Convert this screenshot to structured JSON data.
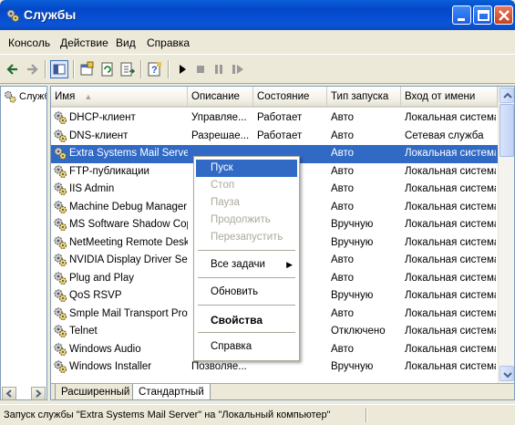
{
  "window": {
    "title": "Службы"
  },
  "menu": {
    "items": [
      "Консоль",
      "Действие",
      "Вид",
      "Справка"
    ]
  },
  "toolbar": {
    "buttons": [
      "back-icon",
      "forward-icon",
      "show-hide-tree-icon",
      "properties-icon",
      "refresh-icon",
      "export-list-icon",
      "help-icon",
      "start-service-icon",
      "stop-service-icon",
      "pause-service-icon",
      "restart-service-icon"
    ]
  },
  "tree": {
    "root_label": "Служб"
  },
  "columns": [
    "Имя",
    "Описание",
    "Состояние",
    "Тип запуска",
    "Вход от имени"
  ],
  "rows": [
    {
      "name": "DHCP-клиент",
      "description": "Управляе...",
      "state": "Работает",
      "startup": "Авто",
      "logon": "Локальная система"
    },
    {
      "name": "DNS-клиент",
      "description": "Разрешае...",
      "state": "Работает",
      "startup": "Авто",
      "logon": "Сетевая служба"
    },
    {
      "name": "Extra Systems Mail Server",
      "description": "",
      "state": "",
      "startup": "Авто",
      "logon": "Локальная система"
    },
    {
      "name": "FTP-публикации",
      "description": "",
      "state": "",
      "startup": "Авто",
      "logon": "Локальная система"
    },
    {
      "name": "IIS Admin",
      "description": "",
      "state": "",
      "startup": "Авто",
      "logon": "Локальная система"
    },
    {
      "name": "Machine Debug Manager",
      "description": "",
      "state": "",
      "startup": "Авто",
      "logon": "Локальная система"
    },
    {
      "name": "MS Software Shadow Cop...",
      "description": "",
      "state": "",
      "startup": "Вручную",
      "logon": "Локальная система"
    },
    {
      "name": "NetMeeting Remote Deskt...",
      "description": "",
      "state": "",
      "startup": "Вручную",
      "logon": "Локальная система"
    },
    {
      "name": "NVIDIA Display Driver Ser...",
      "description": "",
      "state": "",
      "startup": "Авто",
      "logon": "Локальная система"
    },
    {
      "name": "Plug and Play",
      "description": "",
      "state": "",
      "startup": "Авто",
      "logon": "Локальная система"
    },
    {
      "name": "QoS RSVP",
      "description": "",
      "state": "",
      "startup": "Вручную",
      "logon": "Локальная система"
    },
    {
      "name": "Smple Mail Transport Prot...",
      "description": "",
      "state": "",
      "startup": "Авто",
      "logon": "Локальная система"
    },
    {
      "name": "Telnet",
      "description": "",
      "state": "",
      "startup": "Отключено",
      "logon": "Локальная система"
    },
    {
      "name": "Windows Audio",
      "description": "",
      "state": "",
      "startup": "Авто",
      "logon": "Локальная система"
    },
    {
      "name": "Windows Installer",
      "description": "Позволяе...",
      "state": "",
      "startup": "Вручную",
      "logon": "Локальная система"
    }
  ],
  "selected_row_index": 2,
  "context_menu": {
    "start": "Пуск",
    "stop": "Стоп",
    "pause": "Пауза",
    "resume": "Продолжить",
    "restart": "Перезапустить",
    "all_tasks": "Все задачи",
    "refresh": "Обновить",
    "properties": "Свойства",
    "help": "Справка"
  },
  "tabs": [
    "Расширенный",
    "Стандартный"
  ],
  "active_tab": "Стандартный",
  "status": {
    "text": "Запуск службы \"Extra Systems Mail Server\" на \"Локальный компьютер\""
  },
  "colors": {
    "title_bar": "#0348c9",
    "selection": "#316ac5",
    "chrome": "#ece9d8"
  }
}
